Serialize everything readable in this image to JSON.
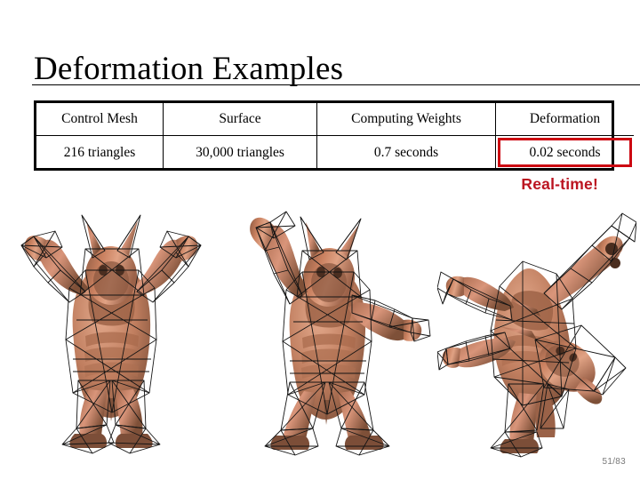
{
  "slide": {
    "title": "Deformation Examples",
    "page_number": "51/83"
  },
  "table": {
    "headers": [
      "Control Mesh",
      "Surface",
      "Computing Weights",
      "Deformation"
    ],
    "row": [
      "216 triangles",
      "30,000 triangles",
      "0.7 seconds",
      "0.02 seconds"
    ],
    "highlight_column_index": 3,
    "highlight_color": "#cc0711"
  },
  "callout": {
    "text": "Real-time!",
    "color": "#bb1420"
  },
  "figures": [
    {
      "name": "control-mesh-armadillo-rest-pose",
      "caption_ref": "Control Mesh",
      "pose": "rest pose, arms raised"
    },
    {
      "name": "deformed-armadillo-pose-a",
      "caption_ref": "Surface",
      "pose": "left arm raised, right arm extended"
    },
    {
      "name": "deformed-armadillo-pose-b",
      "caption_ref": "Deformation",
      "pose": "bent forward, arm thrown back"
    }
  ],
  "colors": {
    "mesh_body": "#c98264",
    "mesh_body_dark": "#8b5a44",
    "mesh_body_light": "#ddA287",
    "wireframe": "#141414",
    "background": "#ffffff"
  }
}
